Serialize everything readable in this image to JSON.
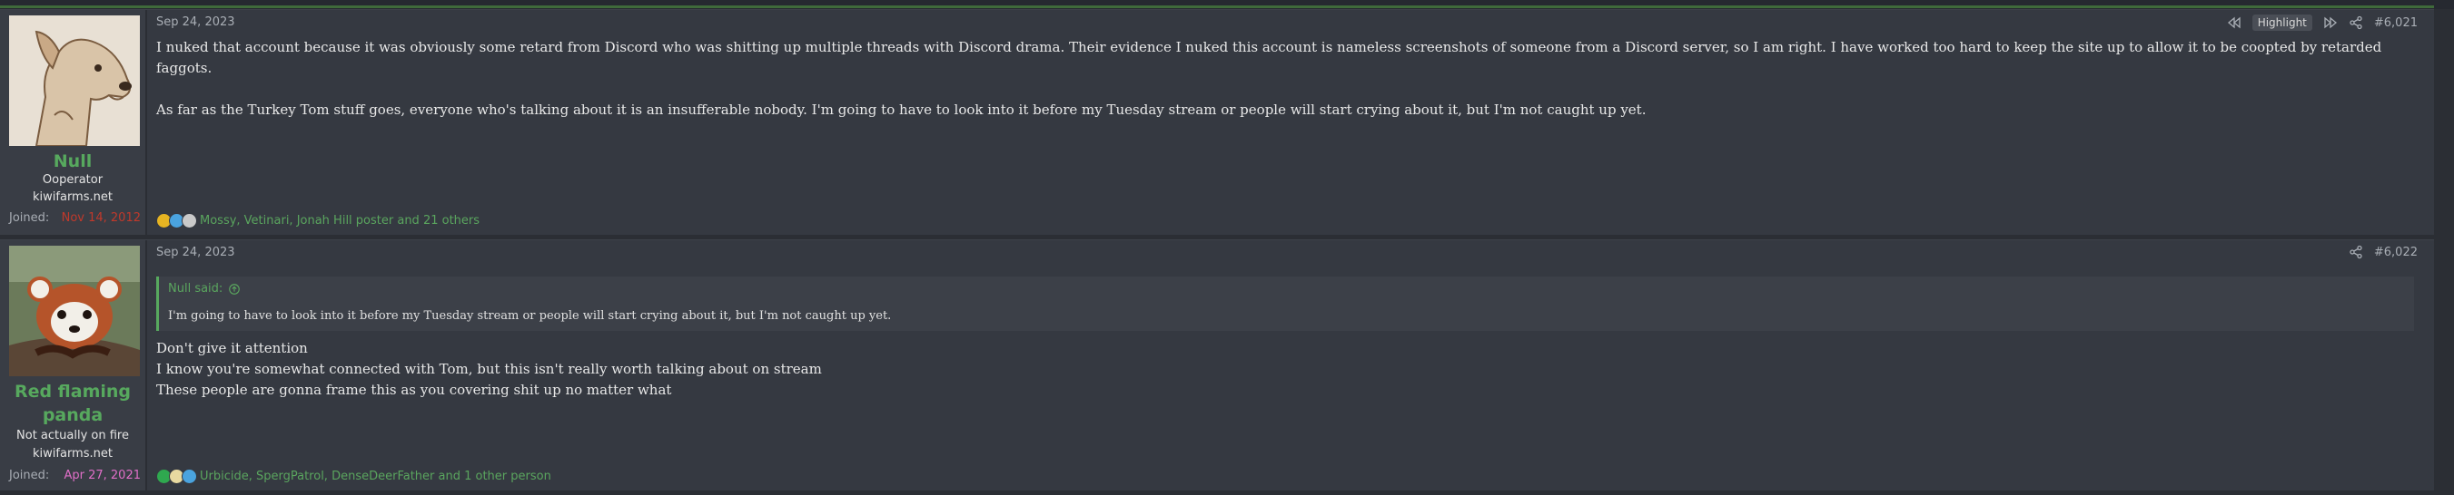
{
  "posts": [
    {
      "user": {
        "name": "Null",
        "title": "Ooperator",
        "site": "kiwifarms.net",
        "joined_label": "Joined:",
        "joined_date": "Nov 14, 2012",
        "joined_color": "#c0392b",
        "avatar_icon": "dog-avatar"
      },
      "date": "Sep 24, 2023",
      "highlight_label": "Highlight",
      "post_number": "#6,021",
      "paragraphs": [
        "I nuked that account because it was obviously some retard from Discord who was shitting up multiple threads with Discord drama. Their evidence I nuked this account is nameless screenshots of someone from a Discord server, so I am right. I have worked too hard to keep the site up to allow it to be coopted by retarded faggots.",
        "As far as the Turkey Tom stuff goes, everyone who's talking about it is an insufferable nobody. I'm going to have to look into it before my Tuesday stream or people will start crying about it, but I'm not caught up yet."
      ],
      "reactions_text": "Mossy, Vetinari, Jonah Hill poster and 21 others"
    },
    {
      "user": {
        "name_line1": "Red flaming",
        "name_line2": "panda",
        "title": "Not actually on fire",
        "site": "kiwifarms.net",
        "joined_label": "Joined:",
        "joined_date": "Apr 27, 2021",
        "joined_color": "#e06fc8",
        "avatar_icon": "red-panda-avatar"
      },
      "date": "Sep 24, 2023",
      "post_number": "#6,022",
      "quote": {
        "author": "Null said:",
        "text": "I'm going to have to look into it before my Tuesday stream or people will start crying about it, but I'm not caught up yet."
      },
      "lines": [
        "Don't give it attention",
        "I know you're somewhat connected with Tom, but this isn't really worth talking about on stream",
        "These people are gonna frame this as you covering shit up no matter what"
      ],
      "reactions_text": "Urbicide, SpergPatrol, DenseDeerFather and 1 other person"
    }
  ]
}
